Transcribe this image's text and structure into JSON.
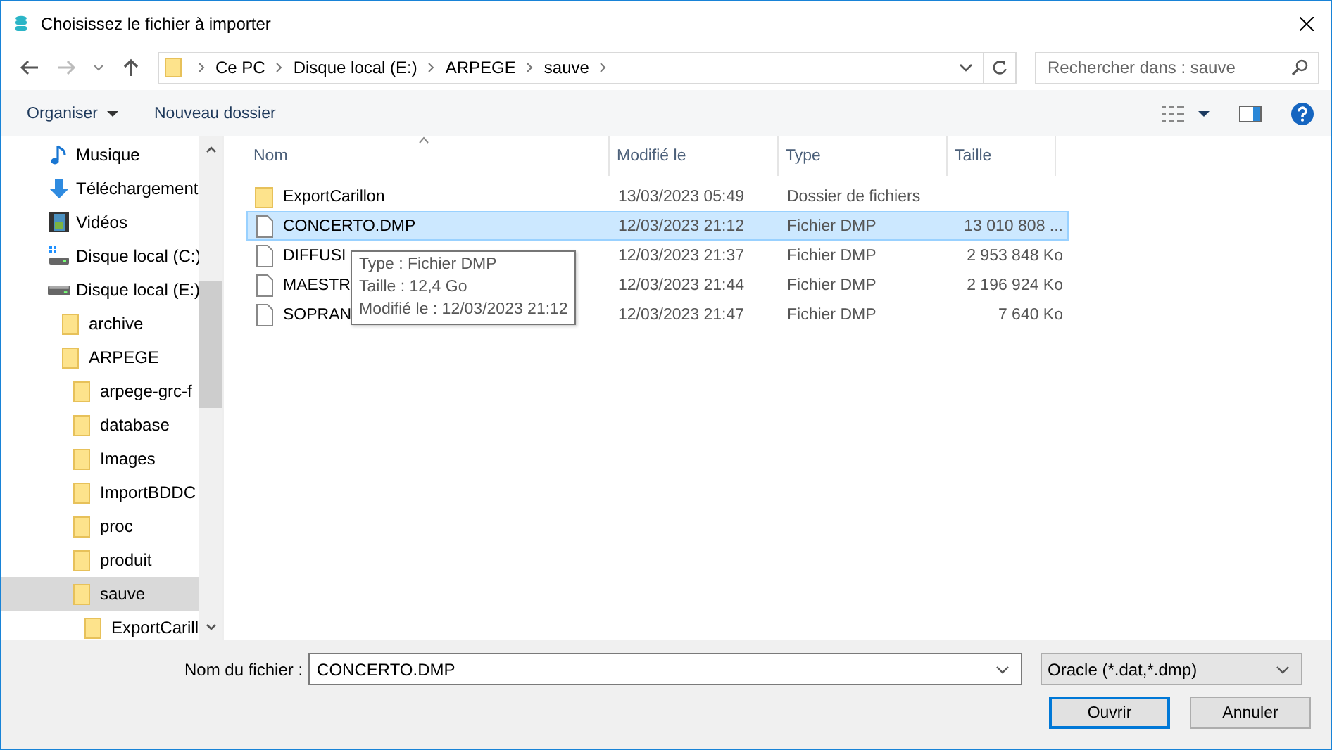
{
  "window": {
    "title": "Choisissez le fichier à importer"
  },
  "breadcrumb": [
    "Ce PC",
    "Disque local (E:)",
    "ARPEGE",
    "sauve"
  ],
  "search": {
    "placeholder": "Rechercher dans : sauve"
  },
  "toolbar": {
    "organize": "Organiser",
    "new_folder": "Nouveau dossier"
  },
  "sidebar": [
    {
      "label": "Musique",
      "kind": "music",
      "selected": false
    },
    {
      "label": "Téléchargement",
      "kind": "download",
      "selected": false
    },
    {
      "label": "Vidéos",
      "kind": "video",
      "selected": false
    },
    {
      "label": "Disque local (C:)",
      "kind": "system_drive",
      "selected": false
    },
    {
      "label": "Disque local (E:)",
      "kind": "drive",
      "selected": false,
      "children": [
        {
          "label": "archive",
          "kind": "folder",
          "selected": false
        },
        {
          "label": "ARPEGE",
          "kind": "folder",
          "selected": false,
          "children": [
            {
              "label": "arpege-grc-f",
              "kind": "folder",
              "selected": false
            },
            {
              "label": "database",
              "kind": "folder",
              "selected": false
            },
            {
              "label": "Images",
              "kind": "folder",
              "selected": false
            },
            {
              "label": "ImportBDDC",
              "kind": "folder",
              "selected": false
            },
            {
              "label": "proc",
              "kind": "folder",
              "selected": false
            },
            {
              "label": "produit",
              "kind": "folder",
              "selected": false
            },
            {
              "label": "sauve",
              "kind": "folder",
              "selected": true,
              "children": [
                {
                  "label": "ExportCarill",
                  "kind": "folder",
                  "selected": false
                }
              ]
            }
          ]
        }
      ]
    }
  ],
  "table": {
    "columns": [
      "Nom",
      "Modifié le",
      "Type",
      "Taille"
    ],
    "rows": [
      {
        "kind": "folder",
        "name": "ExportCarillon",
        "modified": "13/03/2023 05:49",
        "type": "Dossier de fichiers",
        "selected": false
      },
      {
        "kind": "file",
        "name": "CONCERTO.DMP",
        "modified": "12/03/2023 21:12",
        "type": "Fichier DMP",
        "size": "13 010 808 ...",
        "selected": true
      },
      {
        "kind": "file",
        "name": "DIFFUSI",
        "modified": "12/03/2023 21:37",
        "type": "Fichier DMP",
        "size": "2 953 848 Ko",
        "selected": false
      },
      {
        "kind": "file",
        "name": "MAESTR",
        "modified": "12/03/2023 21:44",
        "type": "Fichier DMP",
        "size": "2 196 924 Ko",
        "selected": false
      },
      {
        "kind": "file",
        "name": "SOPRAN",
        "modified": "12/03/2023 21:47",
        "type": "Fichier DMP",
        "size": "7 640 Ko",
        "selected": false
      }
    ]
  },
  "tooltip": [
    "Type : Fichier DMP",
    "Taille : 12,4 Go",
    "Modifié le : 12/03/2023 21:12"
  ],
  "footer": {
    "filename_label": "Nom du fichier :",
    "filename": "CONCERTO.DMP",
    "filter": "Oracle (*.dat,*.dmp)",
    "buttons": [
      {
        "label": "Ouvrir",
        "default": true
      },
      {
        "label": "Annuler",
        "default": false
      }
    ]
  }
}
